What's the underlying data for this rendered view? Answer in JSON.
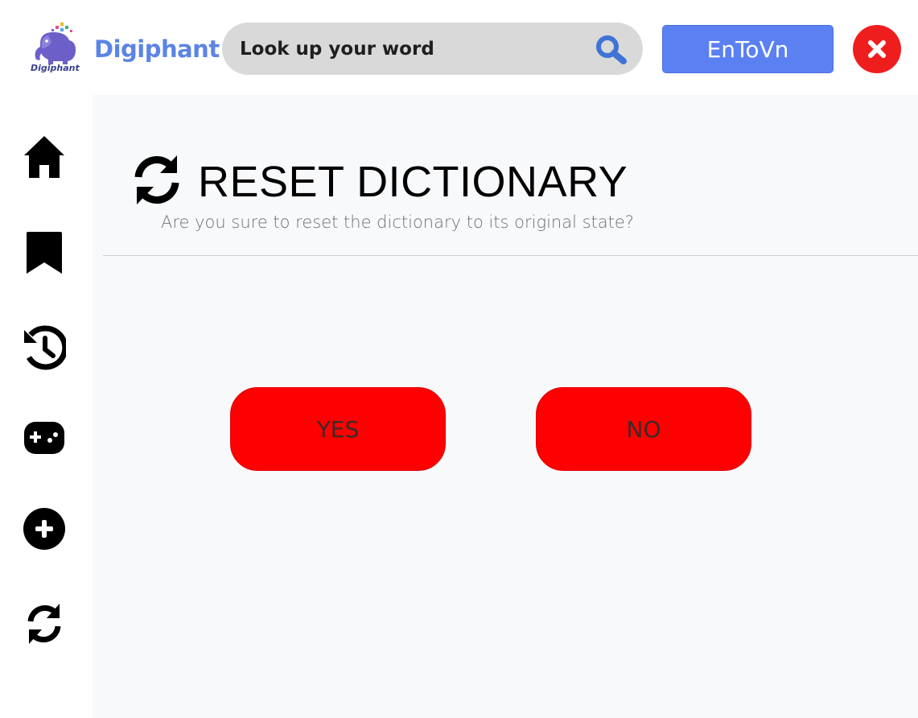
{
  "header": {
    "brand_name": "Digiphant",
    "brand_small": "Digiphant",
    "search_placeholder": "Look up your word",
    "lang_button_label": "EnToVn",
    "close_icon": "close-icon",
    "search_icon": "search-icon"
  },
  "sidebar": {
    "items": [
      {
        "name": "home",
        "icon": "home-icon"
      },
      {
        "name": "bookmark",
        "icon": "bookmark-icon"
      },
      {
        "name": "history",
        "icon": "history-icon"
      },
      {
        "name": "game",
        "icon": "gamepad-icon"
      },
      {
        "name": "add-word",
        "icon": "plus-circle-icon"
      },
      {
        "name": "reset",
        "icon": "sync-icon"
      }
    ]
  },
  "main": {
    "title": "RESET DICTIONARY",
    "subtitle": "Are you sure to reset the dictionary to its original state?",
    "yes_label": "YES",
    "no_label": "NO"
  },
  "colors": {
    "brand_blue": "#5b84e6",
    "lang_button": "#5b80f2",
    "close_red": "#ef1e1e",
    "action_red": "#ff0000",
    "search_bg": "#d9d9d9",
    "main_bg": "#f8f9fb"
  }
}
